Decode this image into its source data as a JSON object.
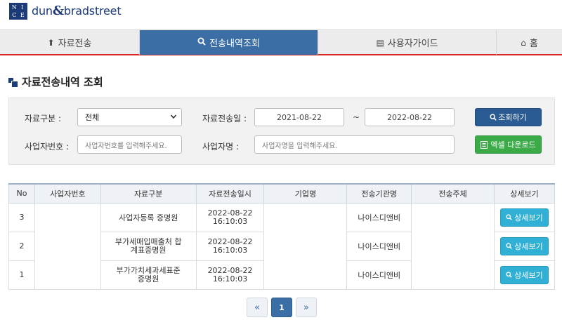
{
  "logo": {
    "letters": [
      "N",
      "I",
      "C",
      "E"
    ],
    "brand": "dun",
    "amp": "&",
    "brand2": "bradstreet"
  },
  "nav": {
    "items": [
      {
        "label": "자료전송",
        "icon": "upload-icon",
        "glyph": "⬆"
      },
      {
        "label": "전송내역조회",
        "icon": "search-icon",
        "glyph": "🔍"
      },
      {
        "label": "사용자가이드",
        "icon": "book-icon",
        "glyph": "▤"
      },
      {
        "label": "홈",
        "icon": "home-icon",
        "glyph": "⌂"
      }
    ],
    "active_index": 1
  },
  "page_title": "자료전송내역 조회",
  "search": {
    "type_label": "자료구분 :",
    "type_value": "전체",
    "date_label": "자료전송일 :",
    "date_from": "2021-08-22",
    "tilde": "~",
    "date_to": "2022-08-22",
    "search_button": "조회하기",
    "bizno_label": "사업자번호 :",
    "bizno_placeholder": "사업자번호를 입력해주세요.",
    "bizname_label": "사업자명 :",
    "bizname_placeholder": "사업자명을 입력해주세요.",
    "excel_button": "엑셀 다운로드"
  },
  "table": {
    "headers": [
      "No",
      "사업자번호",
      "자료구분",
      "자료전송일시",
      "기업명",
      "전송기관명",
      "전송주체",
      "상세보기"
    ],
    "rows": [
      {
        "no": "3",
        "type": "사업자등록 증명원",
        "date": "2022-08-22",
        "time": "16:10:03",
        "agency": "나이스디앤비",
        "detail": "상세보기"
      },
      {
        "no": "2",
        "type_l1": "부가세매입매출처 합",
        "type_l2": "계표증명원",
        "date": "2022-08-22",
        "time": "16:10:03",
        "agency": "나이스디앤비",
        "detail": "상세보기"
      },
      {
        "no": "1",
        "type_l1": "부가가치세과세표준",
        "type_l2": "증명원",
        "date": "2022-08-22",
        "time": "16:10:03",
        "agency": "나이스디앤비",
        "detail": "상세보기"
      }
    ]
  },
  "pager": {
    "prev": "«",
    "current": "1",
    "next": "»"
  }
}
